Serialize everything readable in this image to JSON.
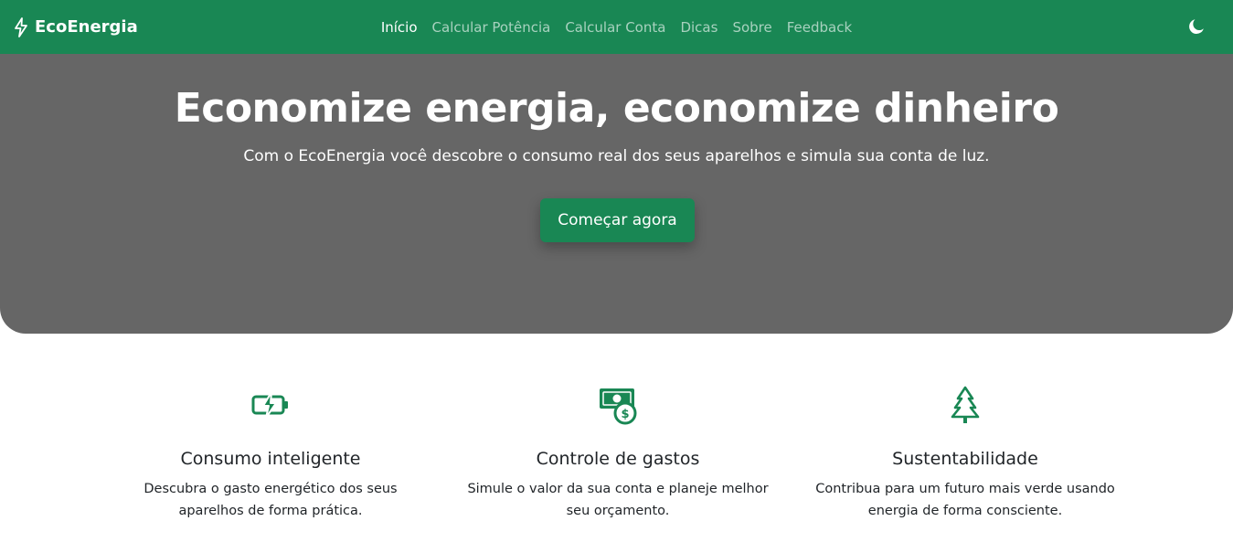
{
  "colors": {
    "brand": "#198754",
    "hero_bg": "#666666"
  },
  "navbar": {
    "brand": "EcoEnergia",
    "brand_icon": "lightning-icon",
    "links": [
      {
        "label": "Início",
        "active": true
      },
      {
        "label": "Calcular Potência",
        "active": false
      },
      {
        "label": "Calcular Conta",
        "active": false
      },
      {
        "label": "Dicas",
        "active": false
      },
      {
        "label": "Sobre",
        "active": false
      },
      {
        "label": "Feedback",
        "active": false
      }
    ],
    "theme_toggle_icon": "moon-icon"
  },
  "hero": {
    "title": "Economize energia, economize dinheiro",
    "subtitle": "Com o EcoEnergia você descobre o consumo real dos seus aparelhos e simula sua conta de luz.",
    "cta_label": "Começar agora"
  },
  "features": [
    {
      "icon": "battery-charging-icon",
      "title": "Consumo inteligente",
      "text": "Descubra o gasto energético dos seus aparelhos de forma prática."
    },
    {
      "icon": "cash-coin-icon",
      "title": "Controle de gastos",
      "text": "Simule o valor da sua conta e planeje melhor seu orçamento."
    },
    {
      "icon": "tree-icon",
      "title": "Sustentabilidade",
      "text": "Contribua para um futuro mais verde usando energia de forma consciente."
    }
  ]
}
